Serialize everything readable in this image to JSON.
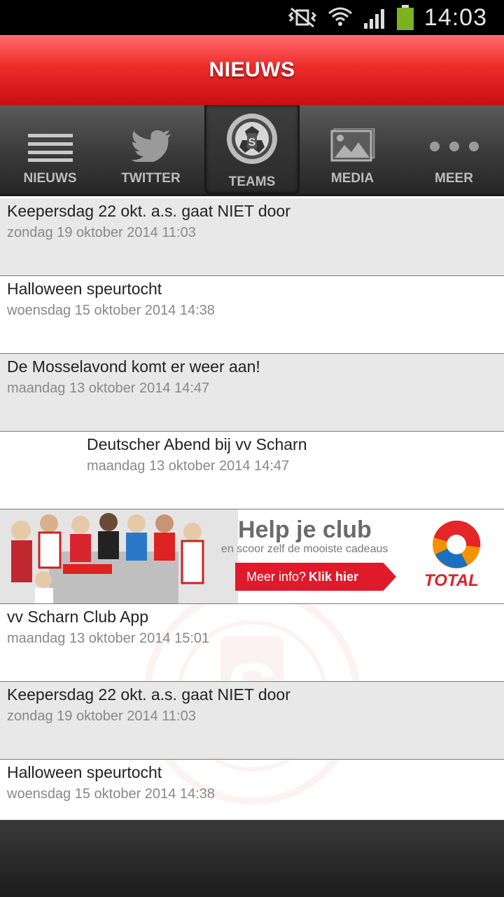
{
  "status_bar": {
    "time": "14:03"
  },
  "header": {
    "title": "NIEUWS"
  },
  "tabs": [
    {
      "label": "NIEUWS"
    },
    {
      "label": "TWITTER"
    },
    {
      "label": "TEAMS"
    },
    {
      "label": "MEDIA"
    },
    {
      "label": "MEER"
    }
  ],
  "news": [
    {
      "title": "Keepersdag 22 okt. a.s. gaat NIET door",
      "date": "zondag 19 oktober 2014 11:03"
    },
    {
      "title": "Halloween speurtocht",
      "date": "woensdag 15 oktober 2014 14:38"
    },
    {
      "title": "De Mosselavond komt er weer aan!",
      "date": "maandag 13 oktober 2014 14:47"
    },
    {
      "title": "Deutscher Abend bij vv Scharn",
      "date": "maandag 13 oktober 2014 14:47"
    },
    {
      "title": "vv Scharn Club App",
      "date": "maandag 13 oktober 2014 15:01"
    },
    {
      "title": "Keepersdag 22 okt. a.s. gaat NIET door",
      "date": "zondag 19 oktober 2014 11:03"
    },
    {
      "title": "Halloween speurtocht",
      "date": "woensdag 15 oktober 2014 14:38"
    }
  ],
  "banner": {
    "headline": "Help je club",
    "subline": "en scoor zelf de mooiste cadeaus",
    "cta_prefix": "Meer info?",
    "cta_strong": "Klik hier",
    "brand": "TOTAL"
  },
  "colors": {
    "accent_red": "#e02020",
    "tab_bg": "#3a3a3a",
    "row_gray": "#e8e8e8"
  }
}
